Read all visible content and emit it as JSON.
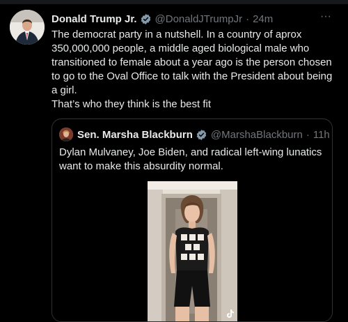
{
  "tweet": {
    "author_name": "Donald Trump Jr.",
    "author_handle": "@DonaldJTrumpJr",
    "separator": "·",
    "time": "24m",
    "more_glyph": "···",
    "text": "The democrat party in a nutshell. In a country of aprox 350,000,000 people, a middle aged biological male who transitioned to female about a year ago is the person chosen to go to the Oval Office to talk with the President about being a girl.\nThat’s who they think is the best fit"
  },
  "quoted_tweet": {
    "author_name": "Sen. Marsha Blackburn",
    "author_handle": "@MarshaBlackburn",
    "separator": "·",
    "time": "11h",
    "text": "Dylan Mulvaney, Joe Biden, and radical left-wing lunatics want to make this absurdity normal.",
    "media_watermark_icon": "tiktok-icon"
  },
  "colors": {
    "background": "#000000",
    "text": "#e7e9ea",
    "secondary_text": "#71767b",
    "verified_badge": "#829aab",
    "border": "#2f3336"
  }
}
